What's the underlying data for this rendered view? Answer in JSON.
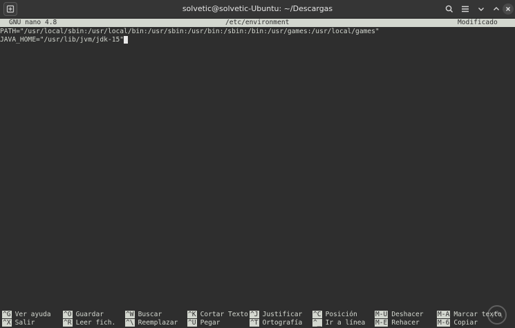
{
  "window": {
    "title": "solvetic@solvetic-Ubuntu: ~/Descargas"
  },
  "status": {
    "app_version": "GNU nano 4.8",
    "file_name": "/etc/environment",
    "state": "Modificado"
  },
  "content": {
    "line1": "PATH=\"/usr/local/sbin:/usr/local/bin:/usr/sbin:/usr/bin:/sbin:/bin:/usr/games:/usr/local/games\"",
    "line2": "JAVA_HOME=\"/usr/lib/jvm/jdk-15\""
  },
  "shortcuts": {
    "row1": [
      {
        "key": "^G",
        "label": "Ver ayuda"
      },
      {
        "key": "^O",
        "label": "Guardar"
      },
      {
        "key": "^W",
        "label": "Buscar"
      },
      {
        "key": "^K",
        "label": "Cortar Texto"
      },
      {
        "key": "^J",
        "label": "Justificar"
      },
      {
        "key": "^C",
        "label": "Posición"
      },
      {
        "key": "M-U",
        "label": "Deshacer"
      },
      {
        "key": "M-A",
        "label": "Marcar texto"
      }
    ],
    "row2": [
      {
        "key": "^X",
        "label": "Salir"
      },
      {
        "key": "^R",
        "label": "Leer fich."
      },
      {
        "key": "^\\",
        "label": "Reemplazar"
      },
      {
        "key": "^U",
        "label": "Pegar"
      },
      {
        "key": "^T",
        "label": "Ortografía"
      },
      {
        "key": "^_",
        "label": "Ir a línea"
      },
      {
        "key": "M-E",
        "label": "Rehacer"
      },
      {
        "key": "M-6",
        "label": "Copiar"
      }
    ]
  },
  "icons": {
    "new_tab": "new-tab-icon",
    "search": "search-icon",
    "menu": "hamburger-menu-icon",
    "minimize": "chevron-down-icon",
    "maximize": "chevron-up-icon",
    "close": "close-icon"
  }
}
